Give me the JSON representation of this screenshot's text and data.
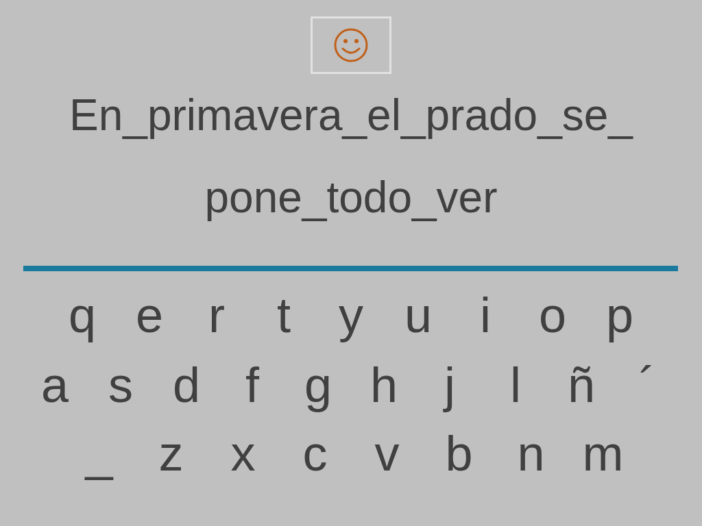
{
  "phrase_lines": [
    "En_primavera_el_prado_se_",
    "pone_todo_ver"
  ],
  "keyboard_rows": [
    [
      "q",
      "e",
      "r",
      "t",
      "y",
      "u",
      "i",
      "o",
      "p"
    ],
    [
      "a",
      "s",
      "d",
      "f",
      "g",
      "h",
      "j",
      "l",
      "ñ",
      "´"
    ],
    [
      "_",
      "z",
      "x",
      "c",
      "v",
      "b",
      "n",
      "m"
    ]
  ]
}
